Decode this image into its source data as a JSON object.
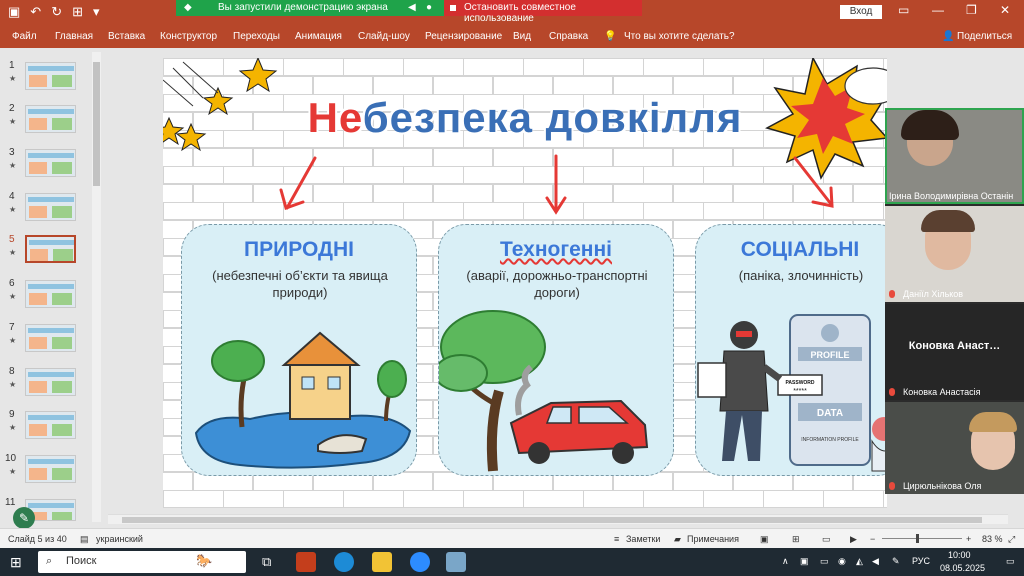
{
  "titlebar": {
    "share_notice": "Вы запустили демонстрацию экрана",
    "stop_share": "Остановить совместное использование",
    "signin": "Вход"
  },
  "menu": {
    "items": [
      "Файл",
      "Главная",
      "Вставка",
      "Конструктор",
      "Переходы",
      "Анимация",
      "Слайд-шоу",
      "Рецензирование",
      "Вид",
      "Справка"
    ],
    "tell_me": "Что вы хотите сделать?",
    "share": "Поделиться"
  },
  "thumbnails": {
    "numbers": [
      "1",
      "2",
      "3",
      "4",
      "5",
      "6",
      "7",
      "8",
      "9",
      "10",
      "11"
    ],
    "star": "★",
    "active": 5
  },
  "slide": {
    "title_highlight": "Не",
    "title_rest": "безпека довкілля",
    "cards": [
      {
        "heading": "ПРИРОДНІ",
        "subtitle": "(небезпечні об’єкти та явища природи)"
      },
      {
        "heading": "Техногенні",
        "subtitle": "(аварії, дорожньо-транспортні дороги)"
      },
      {
        "heading": "СОЦІАЛЬНІ",
        "subtitle": "(паніка, злочинність)"
      }
    ],
    "illustration_text": {
      "profile": "PROFILE",
      "password": "PASSWORD",
      "password_stars": "*****",
      "data": "DATA",
      "information_profile": "INFORMATION PROFILE"
    }
  },
  "video": {
    "participants": [
      {
        "name": "Ірина Володимирівна Останін",
        "speaking": true
      },
      {
        "name": "Даніїл Хільков",
        "speaking": false
      },
      {
        "name": "Коновка Анастасія",
        "display": "Коновка Анаст…",
        "speaking": false
      },
      {
        "name": "Цирюльнікова Оля",
        "speaking": false
      }
    ]
  },
  "status": {
    "slide_counter": "Слайд 5 из 40",
    "language": "украинский",
    "notes": "Заметки",
    "comments": "Примечания",
    "zoom": "83 %"
  },
  "taskbar": {
    "search": "Поиск",
    "lang": "РУС",
    "time": "10:00",
    "date": "08.05.2025"
  },
  "colors": {
    "accent": "#b7472a",
    "share_green": "#1fa34a",
    "stop_red": "#d32f2f",
    "title_blue": "#3a6fb6",
    "title_red": "#e53935",
    "card_bg": "#d9eff6"
  }
}
